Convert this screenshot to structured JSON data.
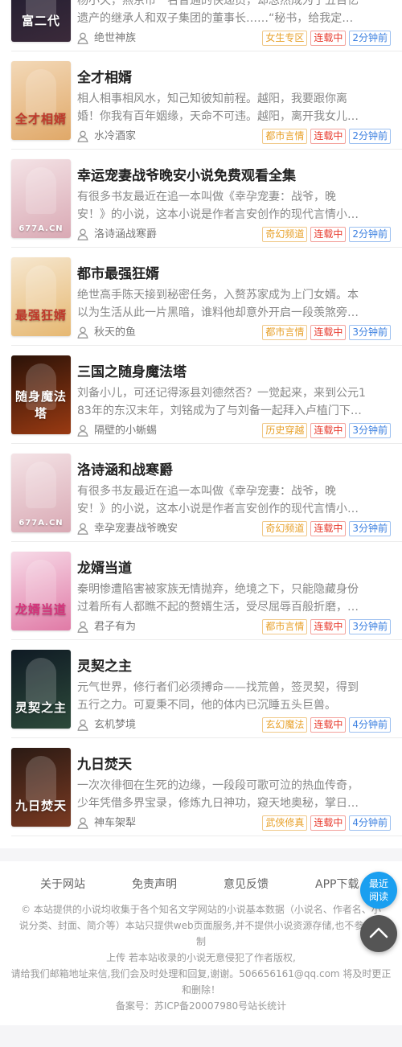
{
  "colors": {
    "accent_blue": "#1a9ff0",
    "tag_category": "#e8a12a",
    "tag_status": "#e8392c",
    "tag_time": "#3a7fe0",
    "text_desc": "#888888",
    "band": "#f5f5f7"
  },
  "books": [
    {
      "title": "",
      "cover_text": "富二代",
      "desc_line1": "杨小天，燕京市一名普通的快递员，却忽然成为了五百亿",
      "desc_line2": "遗产的继承人和双子集团的董事长……“秘书，给我定…",
      "author": "绝世神族",
      "category": "女生专区",
      "status": "连载中",
      "time": "2分钟前",
      "cover_colors": [
        "#1a1a2e",
        "#3b2a3a"
      ],
      "icon": "user-icon"
    },
    {
      "title": "全才相婿",
      "cover_text": "全才相婿",
      "desc_line1": "相人相事相风水，知己知彼知前程。越阳，我要跟你离",
      "desc_line2": "婚！你我有百年姻缘，天命不可违。越阳，离开我女儿…",
      "author": "水冷酒家",
      "category": "都市言情",
      "status": "连载中",
      "time": "2分钟前",
      "cover_colors": [
        "#f3d9b8",
        "#e0a868"
      ],
      "icon": "user-icon"
    },
    {
      "title": "幸运宠妻战爷晚安小说免费观看全集",
      "cover_text": "677A.CN",
      "desc_line1": "有很多书友最近在追一本叫做《幸孕宠妻：战爷，晚",
      "desc_line2": "安！》的小说，这本小说是作者言安创作的现代言情小…",
      "author": "洛诗涵战寒爵",
      "category": "奇幻频道",
      "status": "连载中",
      "time": "2分钟前",
      "cover_colors": [
        "#f4e3e6",
        "#d9a9b4"
      ],
      "icon": "user-icon"
    },
    {
      "title": "都市最强狂婿",
      "cover_text": "最强狂婿",
      "desc_line1": "绝世高手陈天接到秘密任务，入赘苏家成为上门女婿。本",
      "desc_line2": "以为生活从此一片黑暗，谁料他却意外开启一段羡煞旁…",
      "author": "秋天的鱼",
      "category": "都市言情",
      "status": "连载中",
      "time": "3分钟前",
      "cover_colors": [
        "#f6e7cf",
        "#e6b872"
      ],
      "icon": "user-icon"
    },
    {
      "title": "三国之随身魔法塔",
      "cover_text": "随身魔法塔",
      "desc_line1": "刘备小儿，可还记得涿县刘德然否？一觉起来，来到公元1",
      "desc_line2": "83年的东汉末年，刘铭成为了与刘备一起拜入卢植门下…",
      "author": "隔壁的小蜥蜴",
      "category": "历史穿越",
      "status": "连载中",
      "time": "3分钟前",
      "cover_colors": [
        "#2a1208",
        "#9a3a12"
      ],
      "icon": "user-icon"
    },
    {
      "title": "洛诗涵和战寒爵",
      "cover_text": "677A.CN",
      "desc_line1": "有很多书友最近在追一本叫做《幸孕宠妻：战爷，晚",
      "desc_line2": "安！》的小说，这本小说是作者言安创作的现代言情小…",
      "author": "幸孕宠妻战爷晚安",
      "category": "奇幻频道",
      "status": "连载中",
      "time": "3分钟前",
      "cover_colors": [
        "#f4e3e6",
        "#d9a9b4"
      ],
      "icon": "user-icon"
    },
    {
      "title": "龙婿当道",
      "cover_text": "龙婿当道",
      "desc_line1": "秦明惨遭陷害被家族无情抛弃，绝境之下，只能隐藏身份",
      "desc_line2": "过着所有人都瞧不起的赘婿生活，受尽屈辱百般折磨，…",
      "author": "君子有为",
      "category": "都市言情",
      "status": "连载中",
      "time": "3分钟前",
      "cover_colors": [
        "#f7dbe8",
        "#e07aa6"
      ],
      "icon": "user-icon"
    },
    {
      "title": "灵契之主",
      "cover_text": "灵契之主",
      "desc_line1": "元气世界，修行者们必须搏命——找荒兽，签灵契，得到",
      "desc_line2": "五行之力。可夏秉不同，他的体内已沉睡五头巨兽。",
      "author": "玄机梦境",
      "category": "玄幻魔法",
      "status": "连载中",
      "time": "4分钟前",
      "cover_colors": [
        "#0f1a24",
        "#2d4a3a"
      ],
      "icon": "user-icon"
    },
    {
      "title": "九日焚天",
      "cover_text": "九日焚天",
      "desc_line1": "一次次徘徊在生死的边缘，一段段可歌可泣的热血传奇，",
      "desc_line2": "少年凭借多界宝录，修炼九日神功，窥天地奥秘，掌日…",
      "author": "神车架犁",
      "category": "武侠修真",
      "status": "连载中",
      "time": "4分钟前",
      "cover_colors": [
        "#2a1a14",
        "#7a3a22"
      ],
      "icon": "user-icon"
    }
  ],
  "footer": {
    "links": [
      "关于网站",
      "免责声明",
      "意见反馈",
      "APP下载"
    ],
    "notice_line1": "© 本站提供的小说均收集于各个知名文学网站的小说基本数据（小说名、作者名、小",
    "notice_line2": "说分类、封面、简介等）本站只提供web页面服务,并不提供小说资源存储,也不参与录",
    "notice_line3": "制",
    "notice_line4": "上传 若本站收录的小说无意侵犯了作者版权,",
    "notice_line5": "请给我们邮箱地址来信,我们会及时处理和回复,谢谢。506656161@qq.com 将及时更正",
    "notice_line6": "和删除！",
    "icp": "备案号：苏ICP备20007980号站长统计"
  },
  "float": {
    "read_line1": "最近",
    "read_line2": "阅读",
    "top_icon": "chevron-up-icon"
  }
}
